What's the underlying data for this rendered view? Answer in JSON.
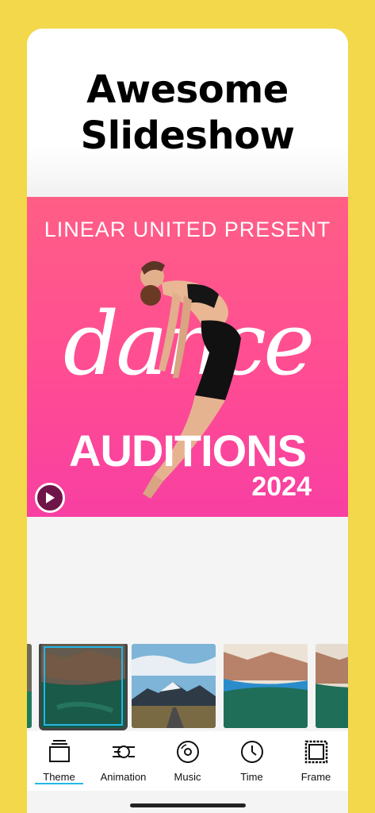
{
  "headline": {
    "line1": "Awesome",
    "line2": "Slideshow"
  },
  "poster": {
    "top_text": "LINEAR UNITED PRESENT",
    "script_text": "dance",
    "title": "AUDITIONS",
    "year": "2024"
  },
  "thumbnails": [
    {
      "name": "thumb-partial-left"
    },
    {
      "name": "thumb-coastal-town",
      "selected": true
    },
    {
      "name": "thumb-mountain-road"
    },
    {
      "name": "thumb-coastal-town-wave"
    },
    {
      "name": "thumb-coastal-partial"
    }
  ],
  "toolbar": {
    "items": [
      {
        "label": "Theme",
        "icon": "theme-icon",
        "active": true
      },
      {
        "label": "Animation",
        "icon": "animation-icon"
      },
      {
        "label": "Music",
        "icon": "music-icon"
      },
      {
        "label": "Time",
        "icon": "clock-icon"
      },
      {
        "label": "Frame",
        "icon": "frame-icon"
      }
    ]
  },
  "colors": {
    "background": "#F2D84A",
    "accent": "#24B6E6",
    "poster_pink": "#FF4C93"
  }
}
